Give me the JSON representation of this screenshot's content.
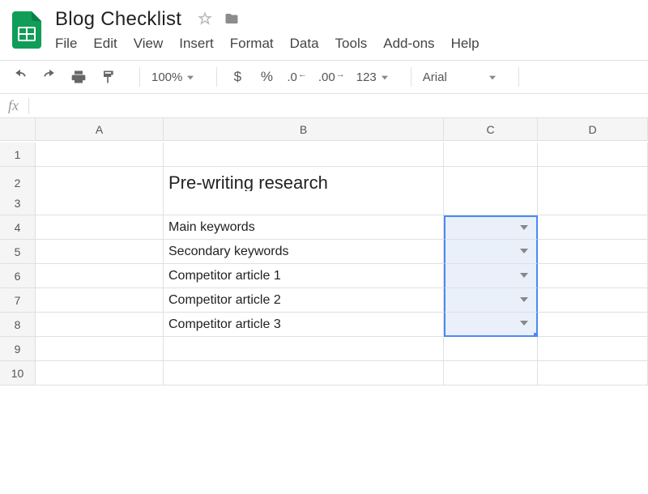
{
  "doc": {
    "title": "Blog Checklist"
  },
  "menu": {
    "file": "File",
    "edit": "Edit",
    "view": "View",
    "insert": "Insert",
    "format": "Format",
    "data": "Data",
    "tools": "Tools",
    "addons": "Add-ons",
    "help": "Help"
  },
  "toolbar": {
    "zoom": "100%",
    "currency": "$",
    "percent": "%",
    "dec_dec": ".0",
    "inc_dec": ".00",
    "num_format": "123",
    "font": "Arial"
  },
  "fx": {
    "label": "fx",
    "value": ""
  },
  "cols": {
    "A": "A",
    "B": "B",
    "C": "C",
    "D": "D"
  },
  "rows": {
    "r1": "1",
    "r2": "2",
    "r3": "3",
    "r4": "4",
    "r5": "5",
    "r6": "6",
    "r7": "7",
    "r8": "8",
    "r9": "9",
    "r10": "10"
  },
  "cells": {
    "b2": "Pre-writing research",
    "b4": "Main keywords",
    "b5": "Secondary keywords",
    "b6": "Competitor article 1",
    "b7": "Competitor article 2",
    "b8": "Competitor article 3"
  }
}
